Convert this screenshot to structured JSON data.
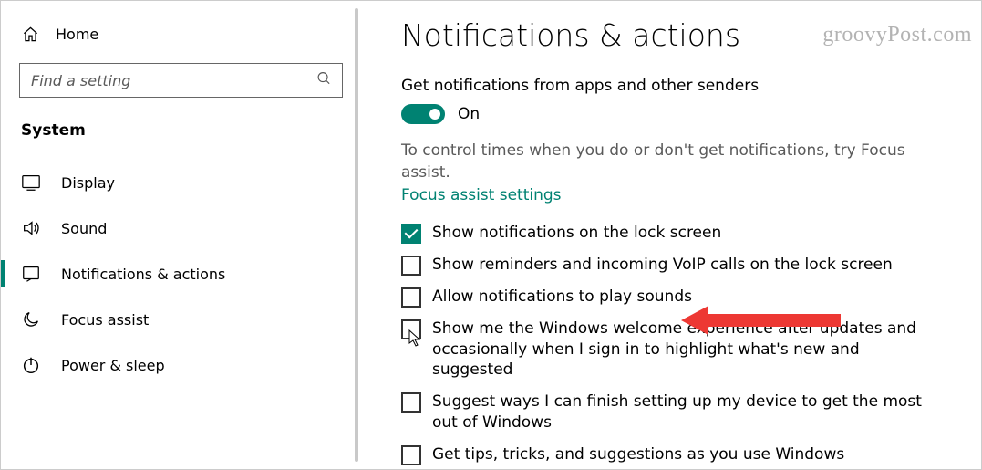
{
  "watermark": "groovyPost.com",
  "sidebar": {
    "home": "Home",
    "search_placeholder": "Find a setting",
    "section": "System",
    "items": [
      {
        "label": "Display"
      },
      {
        "label": "Sound"
      },
      {
        "label": "Notifications & actions"
      },
      {
        "label": "Focus assist"
      },
      {
        "label": "Power & sleep"
      }
    ]
  },
  "main": {
    "title": "Notifications & actions",
    "toggle_heading": "Get notifications from apps and other senders",
    "toggle_state": "On",
    "hint": "To control times when you do or don't get notifications, try Focus assist.",
    "link": "Focus assist settings",
    "checkboxes": [
      {
        "label": "Show notifications on the lock screen",
        "checked": true
      },
      {
        "label": "Show reminders and incoming VoIP calls on the lock screen",
        "checked": false
      },
      {
        "label": "Allow notifications to play sounds",
        "checked": false
      },
      {
        "label": "Show me the Windows welcome experience after updates and occasionally when I sign in to highlight what's new and suggested",
        "checked": false
      },
      {
        "label": "Suggest ways I can finish setting up my device to get the most out of Windows",
        "checked": false
      },
      {
        "label": "Get tips, tricks, and suggestions as you use Windows",
        "checked": false
      }
    ]
  }
}
